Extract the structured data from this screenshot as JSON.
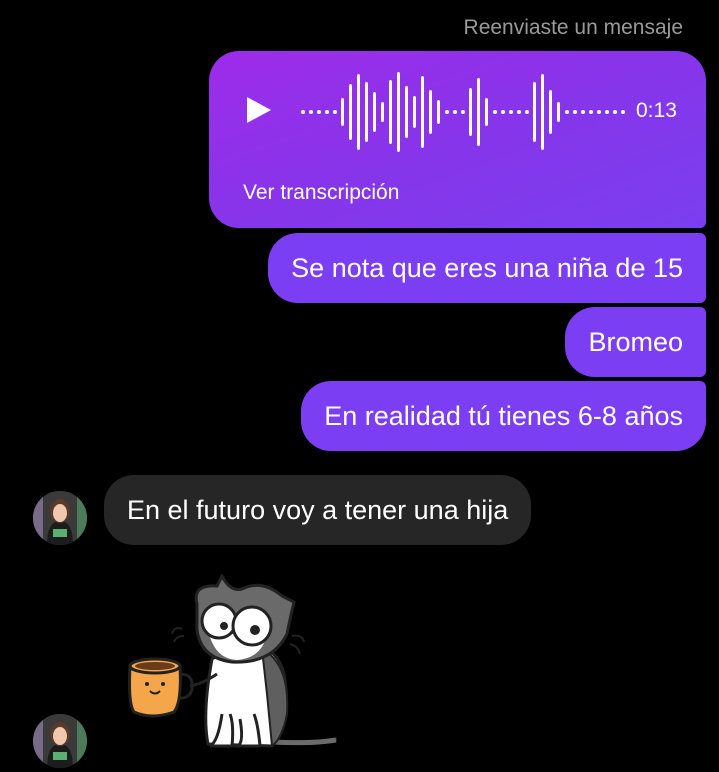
{
  "forward_label": "Reenviaste un mensaje",
  "voice_message": {
    "duration": "0:13",
    "transcript_link": "Ver transcripción",
    "icon": "play-icon"
  },
  "sent_messages": [
    "Se nota que eres una niña de 15",
    "Bromeo",
    "En realidad tú tienes 6-8 años"
  ],
  "received_messages": [
    "En el futuro voy a tener una hija"
  ],
  "sticker": "cat-with-coffee-mug-sticker",
  "colors": {
    "background": "#000000",
    "sent_bubble": "#7b3ef2",
    "voice_bubble_start": "#9d2bea",
    "received_bubble": "#262626",
    "meta_text": "#9a9a9a"
  }
}
